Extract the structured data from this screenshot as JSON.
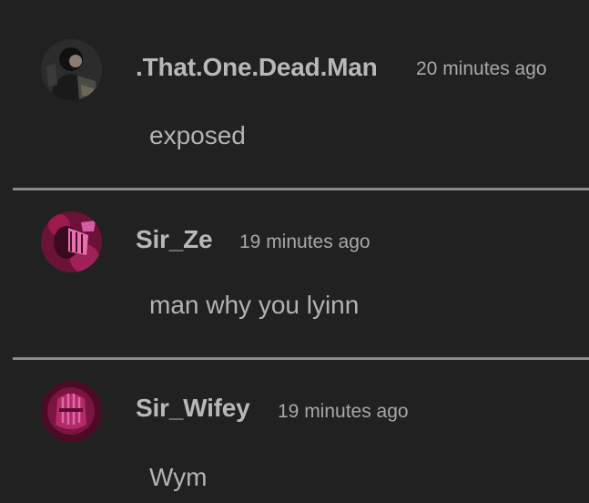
{
  "comments": [
    {
      "username": ".That.One.Dead.Man",
      "timestamp": "20 minutes ago",
      "text": "exposed",
      "avatar_icon": "profile-photo-dark"
    },
    {
      "username": "Sir_Ze",
      "timestamp": "19 minutes ago",
      "text": "man why you lyinn",
      "avatar_icon": "profile-photo-pink-mask"
    },
    {
      "username": "Sir_Wifey",
      "timestamp": "19 minutes ago",
      "text": "Wym",
      "avatar_icon": "profile-photo-pink-hands"
    }
  ],
  "colors": {
    "background": "#212121",
    "username": "#b8b8b8",
    "timestamp": "#a8a8a8",
    "text": "#b3b3b3",
    "divider": "#8a8a8a"
  }
}
